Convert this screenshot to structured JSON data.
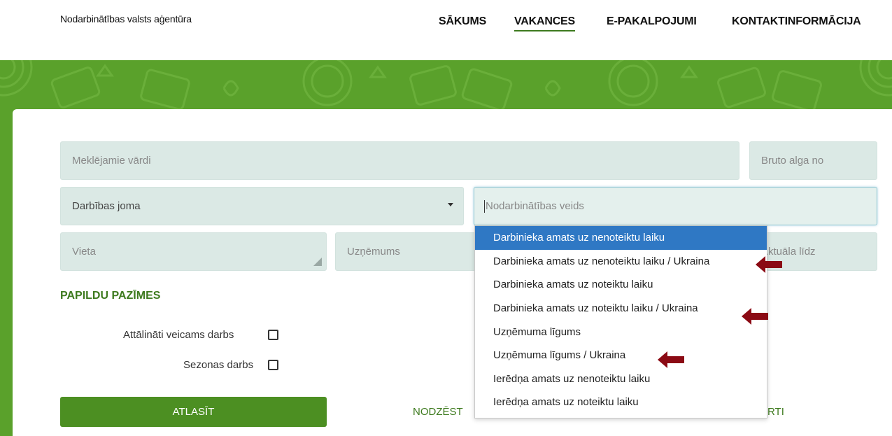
{
  "header": {
    "brand": "Nodarbinātības valsts aģentūra",
    "nav": [
      "SĀKUMS",
      "VAKANCES",
      "E-PAKALPOJUMI",
      "KONTAKTINFORMĀCIJA"
    ]
  },
  "search": {
    "keywords_placeholder": "Meklējamie vārdi",
    "salary_placeholder": "Bruto alga no",
    "field_of_activity": "Darbības joma",
    "employment_type_placeholder": "Nodarbinātības veids",
    "location_placeholder": "Vieta",
    "company_placeholder": "Uzņēmums",
    "valid_until_placeholder": "Aktuāla līdz"
  },
  "extra": {
    "title": "PAPILDU PAZĪMES",
    "remote_label": "Attālināti veicams darbs",
    "seasonal_label": "Sezonas darbs"
  },
  "actions": {
    "submit": "ATLASĪT",
    "clear": "NODZĒST",
    "export_tail": "RTI"
  },
  "dropdown": {
    "items": [
      "Darbinieka amats uz nenoteiktu laiku",
      "Darbinieka amats uz nenoteiktu laiku / Ukraina",
      "Darbinieka amats uz noteiktu laiku",
      "Darbinieka amats uz noteiktu laiku / Ukraina",
      "Uzņēmuma līgums",
      "Uzņēmuma līgums / Ukraina",
      "Ierēdņa amats uz nenoteiktu laiku",
      "Ierēdņa amats uz noteiktu laiku"
    ],
    "highlighted_index": 0
  },
  "colors": {
    "brand_green": "#5aa12b",
    "button_green": "#4c8f22",
    "highlight_blue": "#2f78c4",
    "annotation_arrow": "#8b0a14"
  }
}
